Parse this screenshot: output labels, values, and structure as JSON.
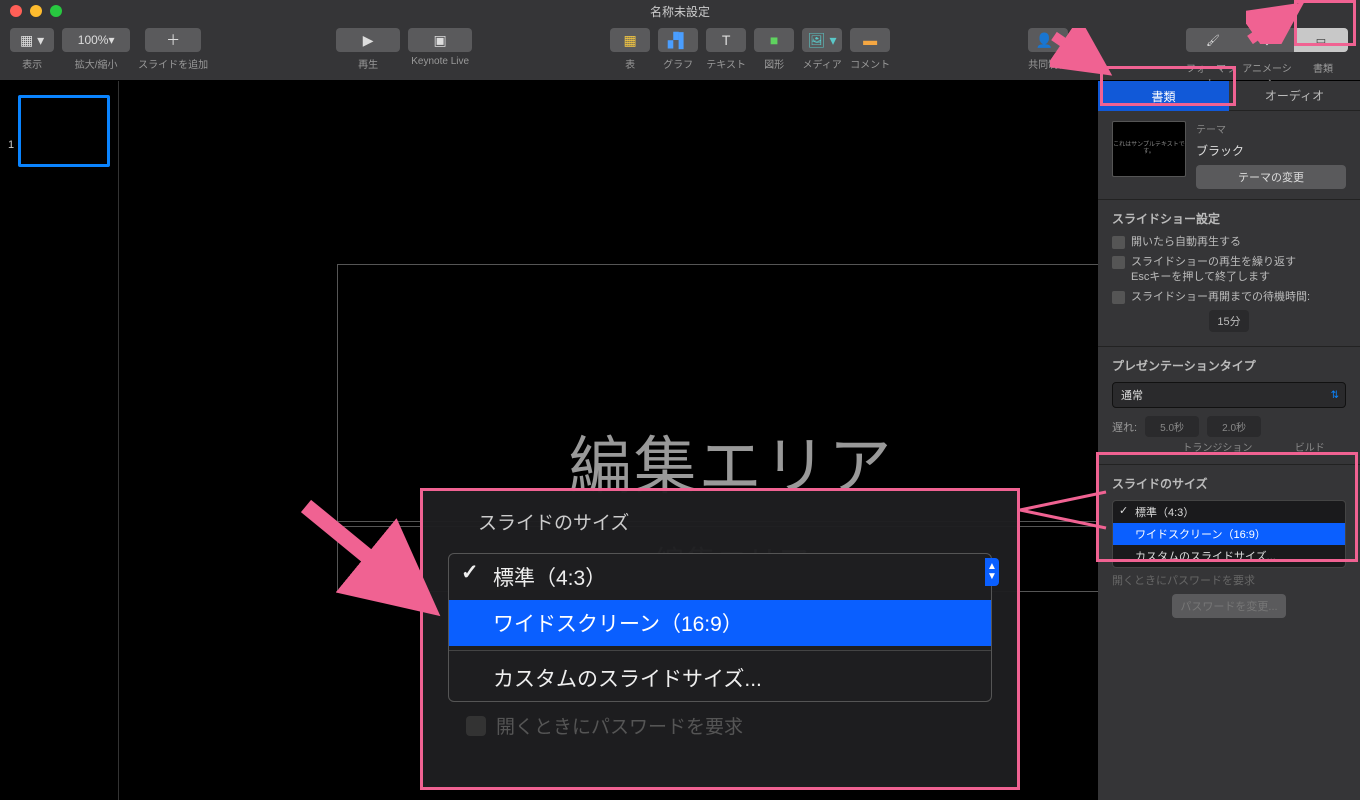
{
  "window_title": "名称未設定",
  "toolbar": {
    "view": "表示",
    "zoom_val": "100%",
    "zoom": "拡大/縮小",
    "add_slide": "スライドを追加",
    "play": "再生",
    "keynote_live": "Keynote Live",
    "table": "表",
    "chart": "グラフ",
    "text": "テキスト",
    "shape": "図形",
    "media": "メディア",
    "comment": "コメント",
    "collab": "共同制作",
    "format": "フォーマット",
    "animate": "アニメーション",
    "document": "書類"
  },
  "thumb": {
    "num": "1"
  },
  "slide": {
    "title": "編集エリア",
    "subtitle": "編集エリア"
  },
  "tabs": {
    "doc": "書類",
    "audio": "オーディオ"
  },
  "theme": {
    "label": "テーマ",
    "name": "ブラック",
    "thumb_text": "これはサンプルテキストです。",
    "change": "テーマの変更"
  },
  "slideshow": {
    "heading": "スライドショー設定",
    "autoplay": "開いたら自動再生する",
    "loop": "スライドショーの再生を繰り返す\nEscキーを押して終了します",
    "idle": "スライドショー再開までの待機時間:",
    "idle_val": "15分"
  },
  "pres_type": {
    "heading": "プレゼンテーションタイプ",
    "value": "通常",
    "delay_lbl": "遅れ:",
    "transition_val": "5.0秒",
    "build_val": "2.0秒",
    "transition": "トランジション",
    "build": "ビルド"
  },
  "slide_size": {
    "heading": "スライドのサイズ",
    "opt_standard": "標準（4:3）",
    "opt_wide": "ワイドスクリーン（16:9）",
    "opt_custom": "カスタムのスライドサイズ...",
    "pw_masked": "開くときにパスワードを要求",
    "pw_change": "パスワードを変更..."
  },
  "zoom": {
    "heading": "スライドのサイズ",
    "opt_standard": "標準（4:3）",
    "opt_wide": "ワイドスクリーン（16:9）",
    "opt_custom": "カスタムのスライドサイズ...",
    "pw": "開くときにパスワードを要求"
  }
}
